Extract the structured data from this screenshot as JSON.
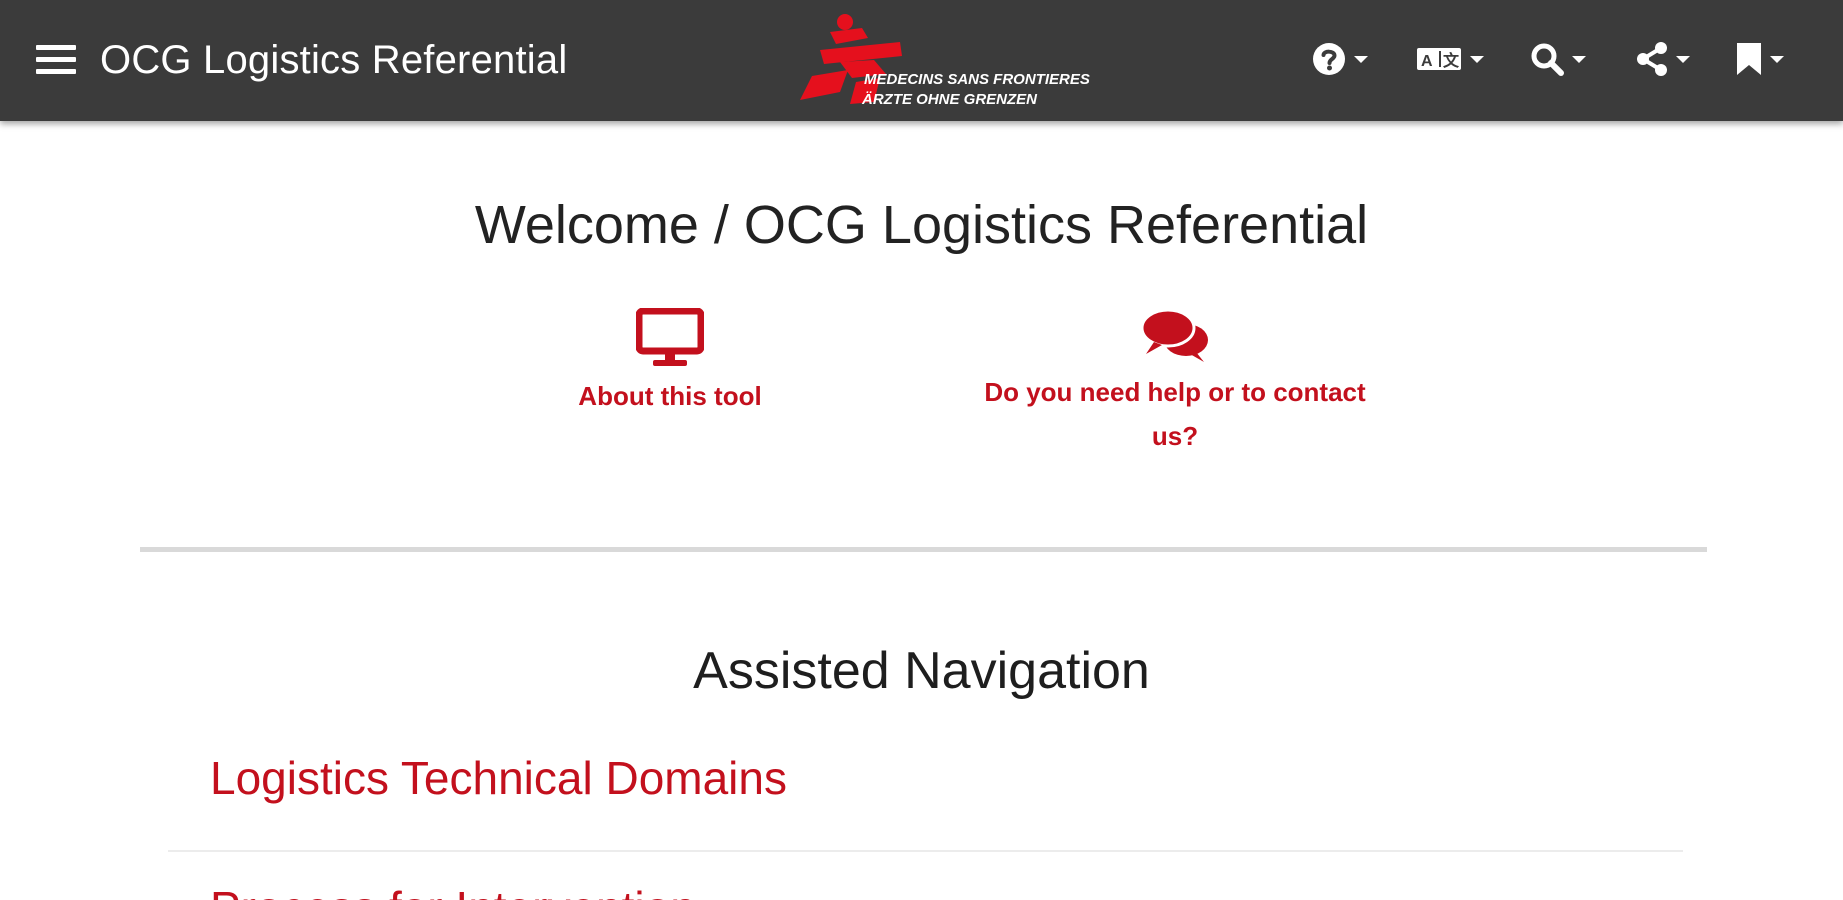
{
  "header": {
    "title": "OCG Logistics Referential",
    "menu_icon": "hamburger-menu-icon",
    "logo": {
      "line1": "MEDECINS SANS FRONTIERES",
      "line2": "ÄRZTE OHNE GRENZEN"
    },
    "toolbar": [
      {
        "icon": "help-icon"
      },
      {
        "icon": "language-icon"
      },
      {
        "icon": "search-icon"
      },
      {
        "icon": "share-icon"
      },
      {
        "icon": "bookmark-icon"
      }
    ]
  },
  "welcome": {
    "title": "Welcome / OCG Logistics Referential"
  },
  "quick_links": [
    {
      "icon": "monitor-icon",
      "label": "About this tool"
    },
    {
      "icon": "chat-bubbles-icon",
      "label": "Do you need help or to contact us?"
    }
  ],
  "assisted_navigation": {
    "title": "Assisted Navigation",
    "items": [
      {
        "label": "Logistics Technical Domains"
      },
      {
        "label": "Process for Intervention"
      }
    ]
  },
  "colors": {
    "topbar": "#3b3b3b",
    "accent": "#c3101d",
    "divider": "#d9d9d9"
  }
}
